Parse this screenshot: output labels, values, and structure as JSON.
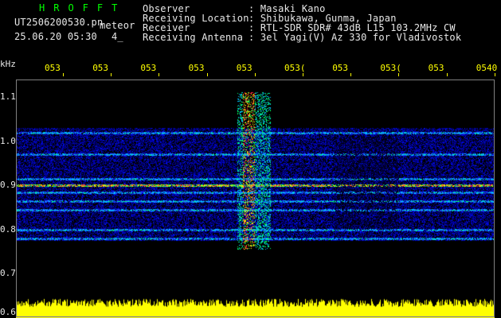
{
  "header": {
    "title": "HROFFT",
    "filename": "UT2506200530.pn",
    "mode": "meteor",
    "datetime": "25.06.20 05:30",
    "page_marker": "4_",
    "fields": [
      {
        "label": "Observer",
        "value": ": Masaki Kano"
      },
      {
        "label": "Receiving Location",
        "value": ": Shibukawa, Gunma, Japan"
      },
      {
        "label": "Receiver",
        "value": ": RTL-SDR SDR# 43dB L15 103.2MHz CW"
      },
      {
        "label": "Receiving Antenna",
        "value": ": 3el Yagi(V) Az 330 for Vladivostok"
      }
    ]
  },
  "axes": {
    "y_unit": "kHz",
    "y_ticks": [
      "1.1",
      "1.0",
      "0.9",
      "0.8",
      "0.7",
      "0.6"
    ],
    "x_ticks": [
      "053",
      "053",
      "053",
      "053",
      "053",
      "053(",
      "053",
      "053(",
      "053",
      "0540"
    ]
  },
  "spectrogram": {
    "freq_range_khz": [
      0.6,
      1.14
    ],
    "signal_bands_khz": [
      1.02,
      0.97,
      0.915,
      0.9,
      0.885,
      0.865,
      0.845,
      0.8,
      0.78
    ],
    "strong_carrier_khz": 0.9,
    "colors": {
      "background": "#000000",
      "noise_floor": "#0000a0",
      "mid": "#00c0ff",
      "high": "#00ff60",
      "peak": "#ff2040",
      "noise_strip": "#ffff00",
      "tick_color": "#ffff00",
      "title_color": "#00ff00"
    }
  }
}
